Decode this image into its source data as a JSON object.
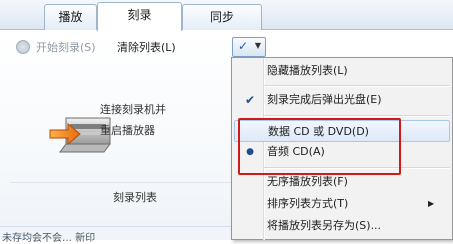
{
  "tabs": [
    {
      "label": "播放"
    },
    {
      "label": "刻录"
    },
    {
      "label": "同步"
    }
  ],
  "toolbar": {
    "start_burn": "开始刻录(S)",
    "clear_list": "清除列表(L)",
    "options_check": "✓",
    "options_caret": "▼"
  },
  "burn_panel": {
    "message_line1": "连接刻录机并",
    "message_line2": "重启播放器",
    "list_title": "刻录列表",
    "bottom_text": "未存均会不会…  新印"
  },
  "menu": {
    "items": [
      {
        "label": "隐藏播放列表(L)",
        "mark": ""
      },
      {
        "label": "刻录完成后弹出光盘(E)",
        "mark": "✔"
      },
      {
        "label": "数据 CD 或 DVD(D)",
        "mark": ""
      },
      {
        "label": "音频 CD(A)",
        "mark": "●"
      },
      {
        "label": "无序播放列表(F)",
        "mark": ""
      },
      {
        "label": "排序列表方式(T)",
        "mark": "",
        "submenu": "▶"
      },
      {
        "label": "将播放列表另存为(S)...",
        "mark": ""
      }
    ]
  },
  "colors": {
    "highlight_frame": "#d21a1a",
    "menu_background": "#f2f2f2"
  }
}
